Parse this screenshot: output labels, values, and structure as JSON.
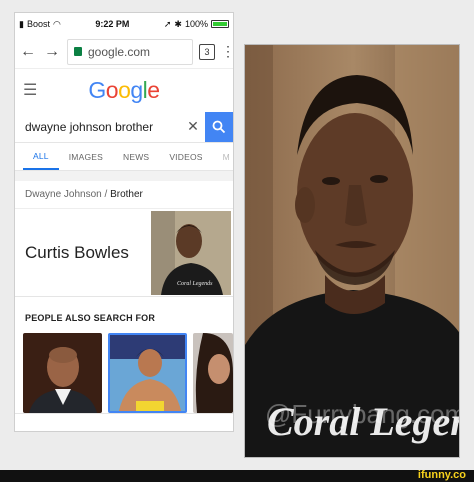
{
  "status_bar": {
    "carrier": "Boost",
    "time": "9:22 PM",
    "battery": "100%"
  },
  "browser": {
    "url": "google.com",
    "tab_count": "3"
  },
  "google": {
    "logo_letters": [
      {
        "char": "G",
        "color": "#4285f4"
      },
      {
        "char": "o",
        "color": "#ea4335"
      },
      {
        "char": "o",
        "color": "#fbbc05"
      },
      {
        "char": "g",
        "color": "#4285f4"
      },
      {
        "char": "l",
        "color": "#34a853"
      },
      {
        "char": "e",
        "color": "#ea4335"
      }
    ],
    "query": "dwayne johnson brother",
    "tabs": [
      "ALL",
      "IMAGES",
      "NEWS",
      "VIDEOS",
      "M"
    ]
  },
  "knowledge": {
    "breadcrumb_parent": "Dwayne Johnson",
    "breadcrumb_sep": "/",
    "breadcrumb_child": "Brother",
    "entity_name": "Curtis Bowles",
    "people_also_search": "PEOPLE ALSO SEARCH FOR"
  },
  "photo": {
    "shirt_text": "Coral Legen",
    "watermark": "@Furrybang.com"
  },
  "footer": {
    "brand": "ifunny.co"
  },
  "colors": {
    "accent": "#1a73e8",
    "search_button": "#4285f4"
  }
}
